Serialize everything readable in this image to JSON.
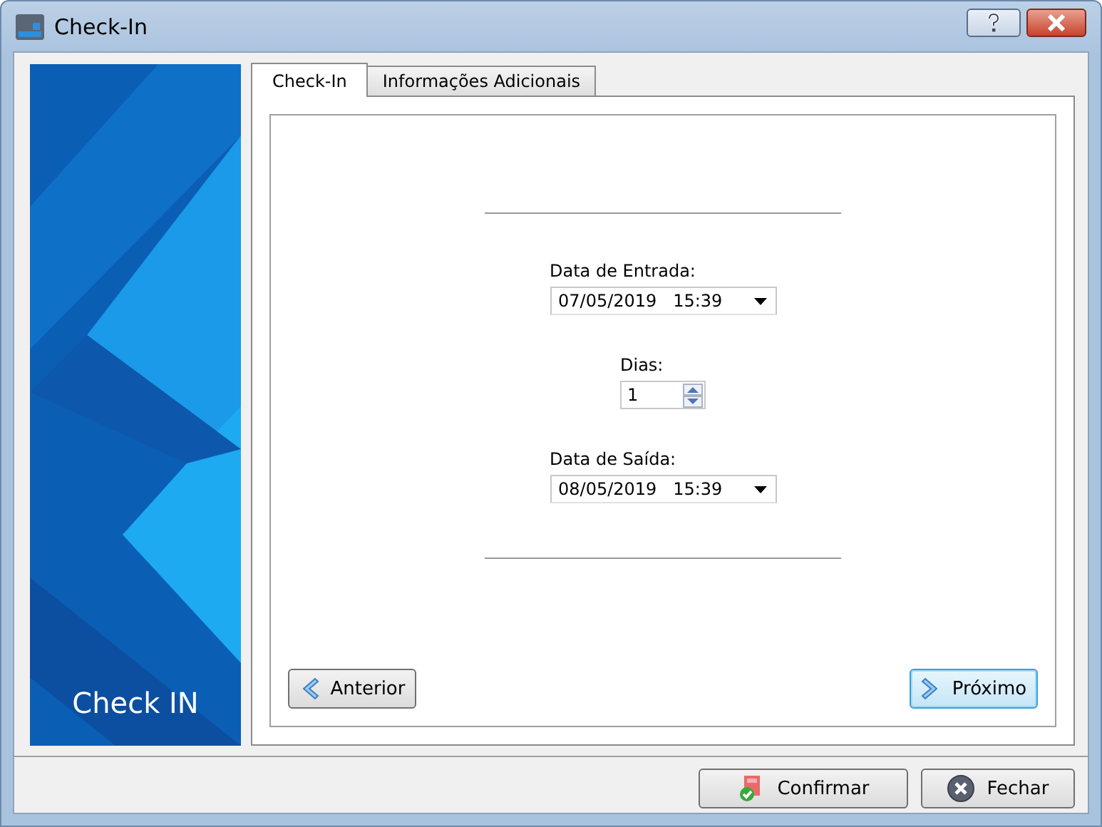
{
  "window": {
    "title": "Check-In"
  },
  "banner": {
    "caption": "Check IN"
  },
  "tabs": [
    {
      "label": "Check-In",
      "selected": true
    },
    {
      "label": "Informações Adicionais",
      "selected": false
    }
  ],
  "form": {
    "entry": {
      "label": "Data de Entrada:",
      "value": "07/05/2019   15:39"
    },
    "days": {
      "label": "Dias:",
      "value": "1"
    },
    "exit": {
      "label": "Data de Saída:",
      "value": "08/05/2019   15:39"
    }
  },
  "nav_buttons": [
    {
      "label": "Anterior",
      "kind": "back",
      "focused": false
    },
    {
      "label": "Próximo",
      "kind": "next",
      "focused": true
    }
  ],
  "footer_buttons": [
    {
      "label": "Confirmar",
      "kind": "confirm"
    },
    {
      "label": "Fechar",
      "kind": "close"
    }
  ]
}
